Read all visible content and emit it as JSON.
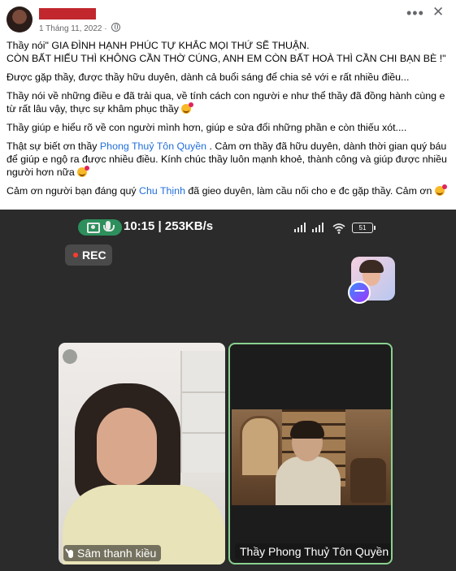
{
  "post": {
    "date": "1 Tháng 11, 2022",
    "privacy_icon": "globe-icon",
    "more_icon": "•••",
    "close_icon": "✕",
    "paragraphs": {
      "p1_line1": "Thầy nói\" GIA ĐÌNH HẠNH PHÚC TỰ KHẮC MỌI THỨ SẼ THUẬN.",
      "p1_line2": "CÒN BẤT HIẾU THÌ KHÔNG CẦN THỜ CÚNG, ANH EM CÒN BẤT HOÀ THÌ CẦN CHI BẠN BÈ  !\"",
      "p2": "Được gặp thầy, được thầy hữu duyên, dành cả buổi sáng để chia sẻ với e rất nhiều điều...",
      "p3": "Thầy nói về những điều e đã trải qua, về tính cách con người e như thể thầy đã đồng hành cùng e từ rất lâu vậy, thực sự khâm phục thầy",
      "p4": "Thầy giúp e hiểu rõ về con người mình hơn, giúp e sửa đổi những phần e còn thiếu xót....",
      "p5_pre": "Thật sự biết ơn thầy ",
      "p5_link": "Phong Thuỷ Tôn Quyền",
      "p5_post": " . Cảm ơn thầy đã hữu duyên, dành thời gian quý báu để giúp e ngộ ra được nhiều điều. Kính chúc thầy luôn mạnh khoẻ, thành công và giúp được nhiều người hơn nữa",
      "p6_pre": "Cảm ơn người bạn đáng quý ",
      "p6_link": "Chu Thịnh",
      "p6_post": " đã gieo duyên, làm cầu nối cho e đc gặp thầy. Cảm ơn"
    }
  },
  "call": {
    "clock": "10:15 | 253KB/s",
    "battery": "51",
    "rec": "REC",
    "left_name": "Sâm thanh kiều",
    "right_name": "Thầy Phong Thuỷ Tôn Quyền"
  },
  "colors": {
    "link": "#216fdb",
    "active_border": "#8ad18f",
    "pill": "#2d8f5c"
  }
}
